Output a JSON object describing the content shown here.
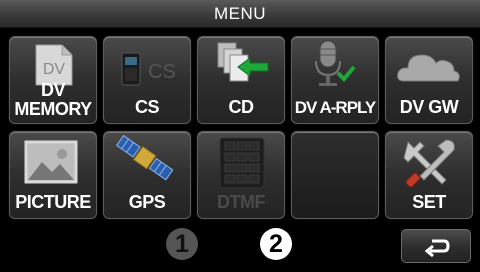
{
  "title": "MENU",
  "menu": {
    "items": [
      {
        "icon": "dv-memory-icon",
        "label": "DV\nMEMORY",
        "enabled": true
      },
      {
        "icon": "cs-radio-icon",
        "label": "CS",
        "enabled": true
      },
      {
        "icon": "cd-copy-icon",
        "label": "CD",
        "enabled": true
      },
      {
        "icon": "microphone-reply-icon",
        "label": "DV A-RPLY",
        "enabled": true
      },
      {
        "icon": "cloud-icon",
        "label": "DV GW",
        "enabled": true
      },
      {
        "icon": "picture-icon",
        "label": "PICTURE",
        "enabled": true
      },
      {
        "icon": "satellite-icon",
        "label": "GPS",
        "enabled": true
      },
      {
        "icon": "keypad-icon",
        "label": "DTMF",
        "enabled": false
      },
      {
        "icon": "",
        "label": "",
        "enabled": false
      },
      {
        "icon": "tools-icon",
        "label": "SET",
        "enabled": true
      }
    ],
    "dv_badge": "DV",
    "cs_badge": "CS",
    "dv_line1": "DV",
    "dv_line2": "MEMORY"
  },
  "pager": {
    "page1": "1",
    "page2": "2",
    "current": 2
  },
  "back": {
    "icon": "return-arrow-icon"
  },
  "colors": {
    "accent_green": "#1fa83a",
    "disabled": "#4a4a4a"
  }
}
